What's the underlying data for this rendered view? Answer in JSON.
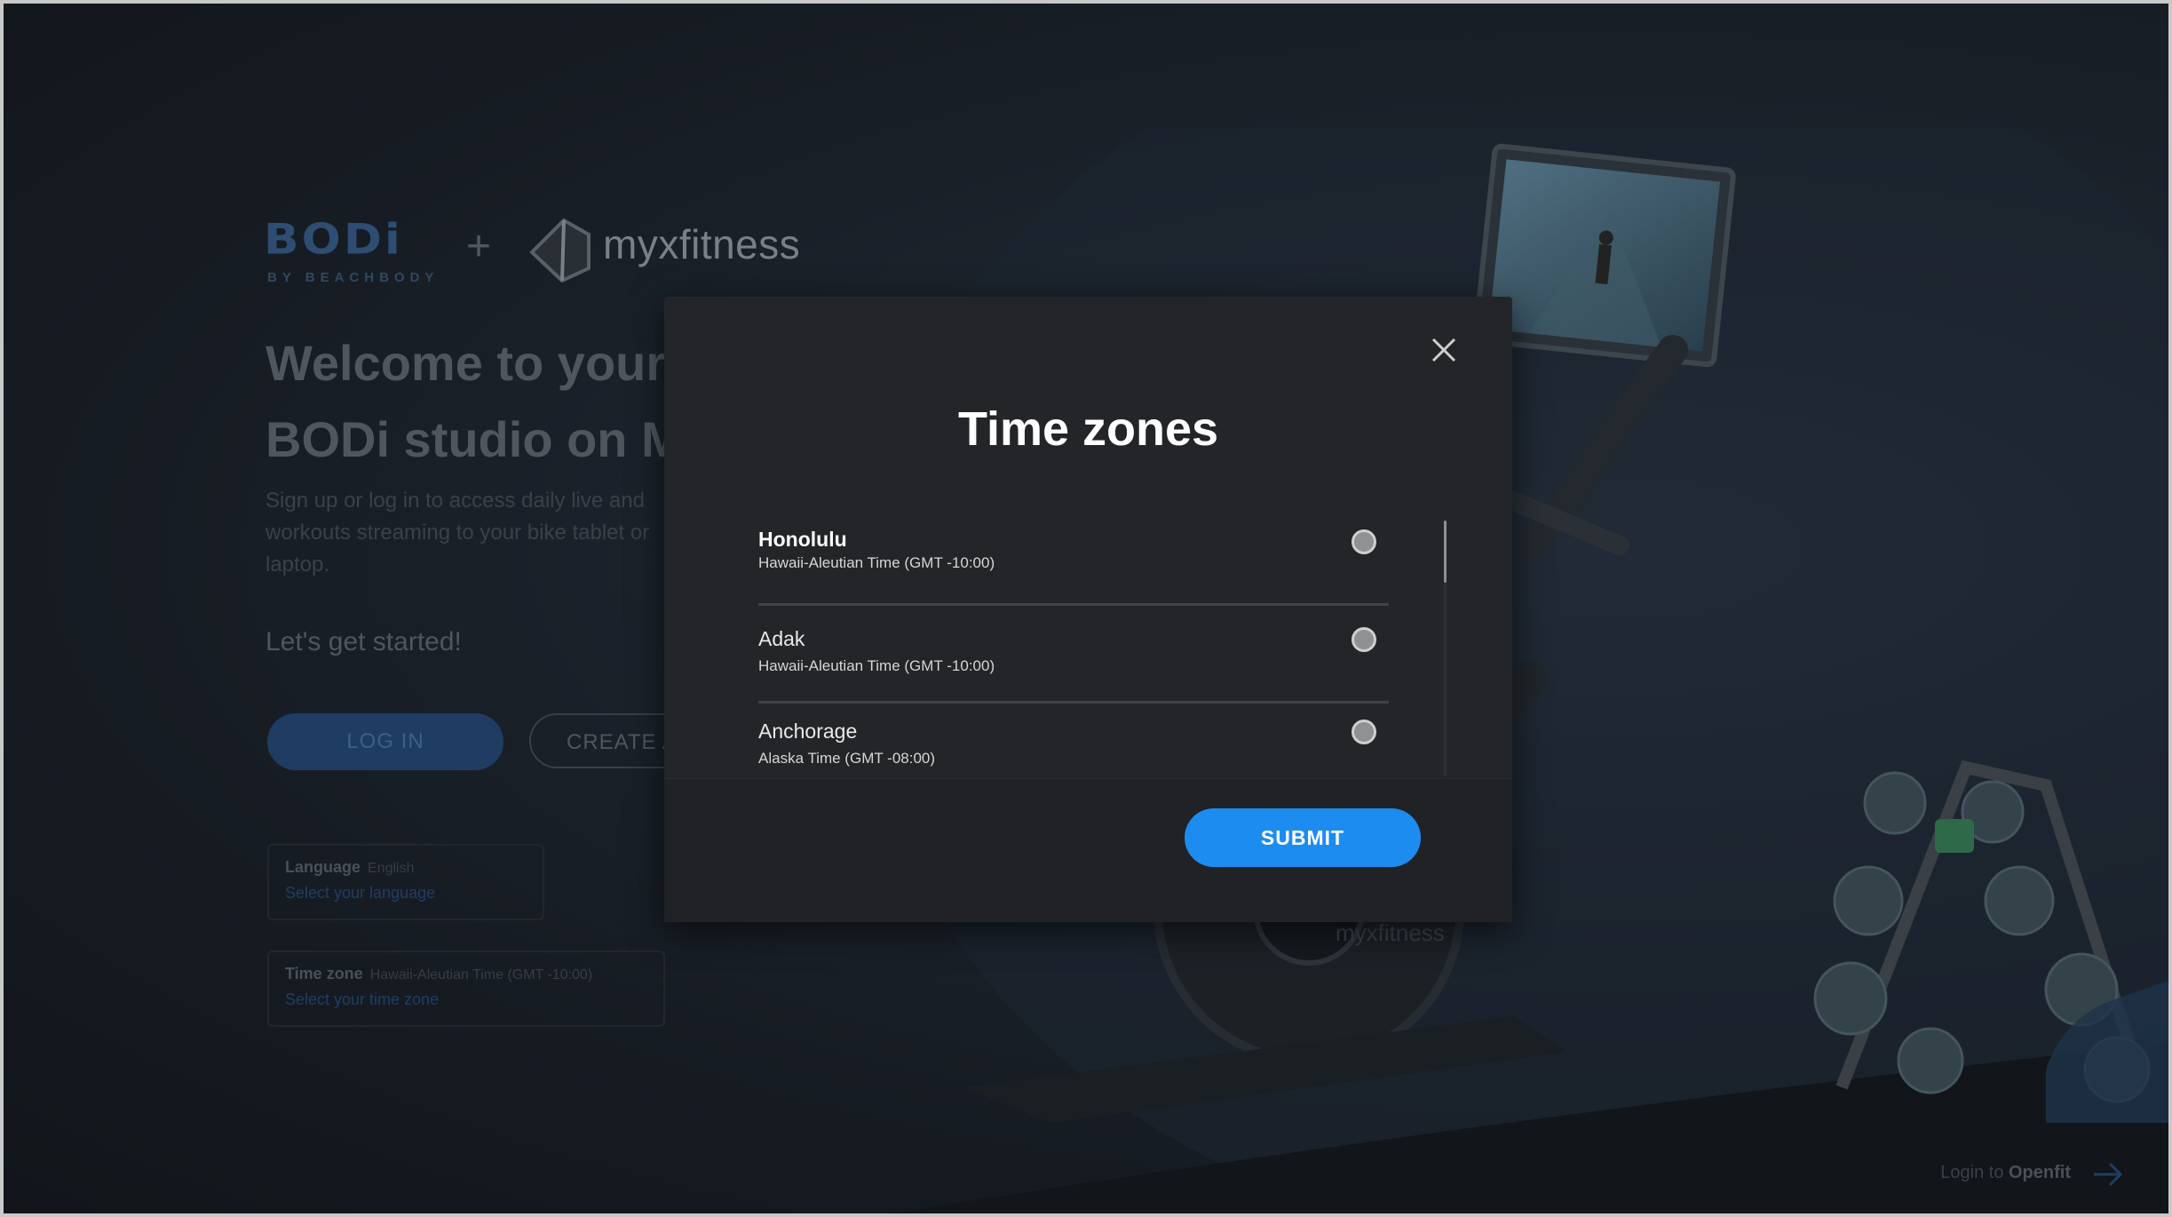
{
  "background": {
    "brand": {
      "bodi_logo": "BODi",
      "bodi_sub": "BY BEACHBODY",
      "plus": "+",
      "partner_name": "myxfitness"
    },
    "welcome_title": "Welcome to your BODi studio on M",
    "intro_text": "Sign up or log in to access daily live and workouts streaming to your bike tablet or laptop.",
    "get_started": "Let's get started!",
    "login_label": "LOG IN",
    "create_label": "CREATE A",
    "language_card": {
      "label": "Language",
      "value": "English",
      "link": "Select your language"
    },
    "timezone_card": {
      "label": "Time zone",
      "value": "Hawaii-Aleutian Time (GMT -10:00)",
      "link": "Select your time zone"
    },
    "openfit_prefix": "Login to",
    "openfit_brand": "Openfit",
    "bike_brand": "myxfitness"
  },
  "modal": {
    "title": "Time zones",
    "items": [
      {
        "name": "Honolulu",
        "description": "Hawaii-Aleutian Time (GMT -10:00)",
        "selected": true
      },
      {
        "name": "Adak",
        "description": "Hawaii-Aleutian Time (GMT -10:00)",
        "selected": false
      },
      {
        "name": "Anchorage",
        "description": "Alaska Time (GMT -08:00)",
        "selected": false
      }
    ],
    "submit_label": "SUBMIT"
  },
  "colors": {
    "accent": "#1d8cf0",
    "modal_bg": "#232528",
    "page_bg": "#161b22"
  }
}
